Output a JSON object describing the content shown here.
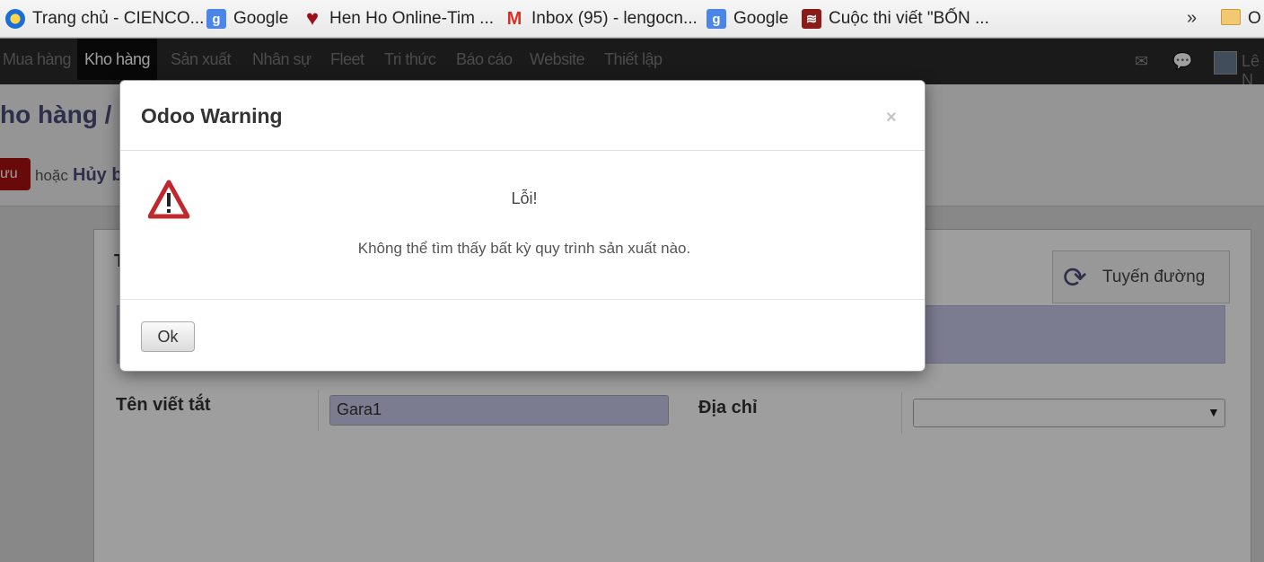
{
  "bookmarks": [
    {
      "label": "Trang chủ - CIENCO...",
      "icon": "ie-icon"
    },
    {
      "label": "Google",
      "icon": "google-icon"
    },
    {
      "label": "Hen Ho Online-Tim ...",
      "icon": "heart-icon"
    },
    {
      "label": "Inbox (95) - lengocn...",
      "icon": "gmail-icon"
    },
    {
      "label": "Google",
      "icon": "google-icon"
    },
    {
      "label": "Cuộc thi viết \"BỐN ...",
      "icon": "rss-icon"
    }
  ],
  "bookmarks_more": "»",
  "bookmarks_other": "O",
  "nav": {
    "items": [
      "Mua hàng",
      "Kho hàng",
      "Sản xuất",
      "Nhân sự",
      "Fleet",
      "Tri thức",
      "Báo cáo",
      "Website",
      "Thiết lập"
    ],
    "active": "Kho hàng",
    "user": "Lê N"
  },
  "header": {
    "breadcrumb": "ho hàng /",
    "save_label": "ưu",
    "or_text": "hoặc",
    "cancel_label": "Hủy b"
  },
  "form": {
    "sheet_letter": "T",
    "route_button": "Tuyến đường",
    "short_name_label": "Tên viết tắt",
    "short_name_value": "Gara1",
    "address_label": "Địa chỉ",
    "address_value": ""
  },
  "dialog": {
    "title": "Odoo Warning",
    "close": "×",
    "message_title": "Lỗi!",
    "message": "Không thể tìm thấy bất kỳ quy trình sản xuất nào.",
    "ok_label": "Ok"
  },
  "colors": {
    "brand_purple": "#4c4c7a",
    "danger_red": "#aa1111",
    "field_highlight": "#c9c9ea"
  }
}
